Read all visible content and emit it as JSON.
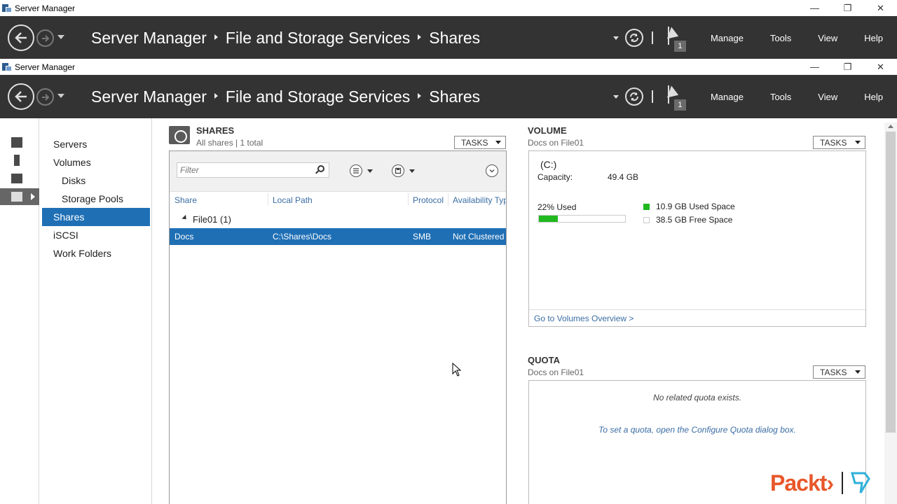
{
  "window": {
    "title": "Server Manager",
    "controls": {
      "minimize": "—",
      "restore": "❐",
      "close": "✕"
    }
  },
  "header": {
    "breadcrumb": [
      "Server Manager",
      "File and Storage Services",
      "Shares"
    ],
    "notification_count": "1",
    "menu": [
      "Manage",
      "Tools",
      "View",
      "Help"
    ]
  },
  "sidebar": {
    "items": [
      {
        "label": "Servers",
        "indent": false,
        "active": false
      },
      {
        "label": "Volumes",
        "indent": false,
        "active": false
      },
      {
        "label": "Disks",
        "indent": true,
        "active": false
      },
      {
        "label": "Storage Pools",
        "indent": true,
        "active": false
      },
      {
        "label": "Shares",
        "indent": false,
        "active": true
      },
      {
        "label": "iSCSI",
        "indent": false,
        "active": false
      },
      {
        "label": "Work Folders",
        "indent": false,
        "active": false
      }
    ]
  },
  "shares": {
    "title": "SHARES",
    "subtitle": "All shares | 1 total",
    "tasks_label": "TASKS",
    "filter_placeholder": "Filter",
    "columns": [
      "Share",
      "Local Path",
      "Protocol",
      "Availability Typ"
    ],
    "group": "File01 (1)",
    "rows": [
      {
        "share": "Docs",
        "path": "C:\\Shares\\Docs",
        "protocol": "SMB",
        "availability": "Not Clustered"
      }
    ]
  },
  "volume": {
    "title": "VOLUME",
    "subtitle": "Docs on File01",
    "tasks_label": "TASKS",
    "drive": "(C:)",
    "capacity_label": "Capacity:",
    "capacity_value": "49.4 GB",
    "used_percent_label": "22% Used",
    "used_fraction": 0.22,
    "used_space": "10.9 GB Used Space",
    "free_space": "38.5 GB Free Space",
    "used_color": "#1fb81f",
    "link": "Go to Volumes Overview >"
  },
  "quota": {
    "title": "QUOTA",
    "subtitle": "Docs on File01",
    "tasks_label": "TASKS",
    "message": "No related quota exists.",
    "link": "To set a quota, open the Configure Quota dialog box."
  },
  "brand": {
    "logo_text": "Packt›"
  }
}
